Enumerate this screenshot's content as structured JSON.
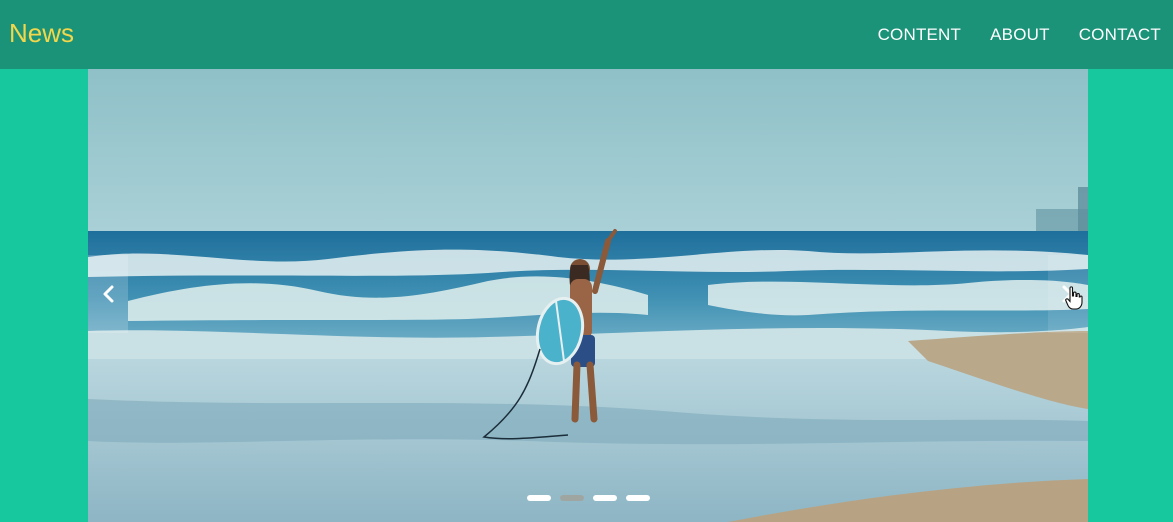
{
  "header": {
    "brand": "News",
    "nav": [
      "CONTENT",
      "ABOUT",
      "CONTACT"
    ]
  },
  "carousel": {
    "image_description_icon": "beach-surfer-image",
    "prev_icon": "chevron-left-icon",
    "next_icon": "chevron-right-icon",
    "slide_count": 4,
    "active_index": 1
  },
  "colors": {
    "page_bg": "#17c79e",
    "navbar_bg": "#1a9378",
    "brand": "#f2d64b",
    "nav_text": "#ffffff"
  }
}
